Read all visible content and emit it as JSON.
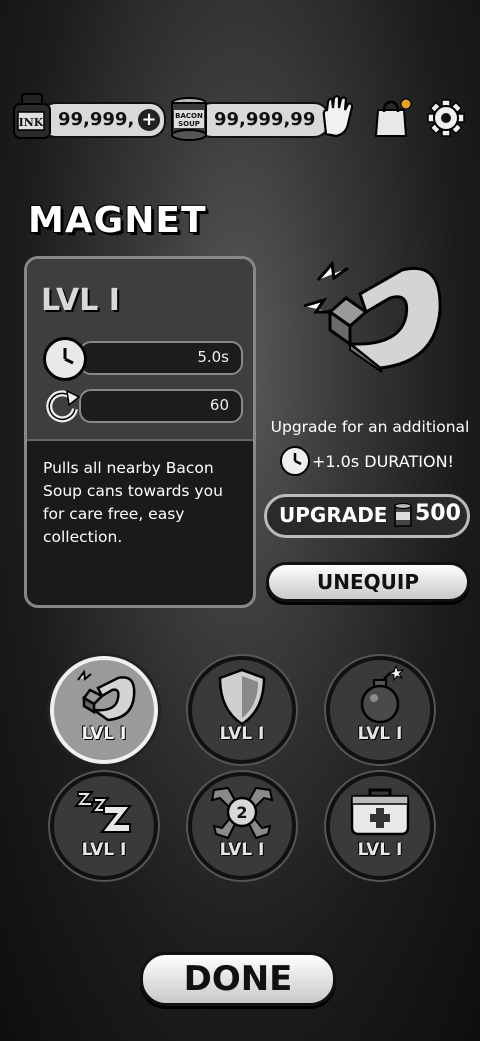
{
  "currency": {
    "ink_amount": "99,999,",
    "ink_label": "INK",
    "plus_label": "+",
    "soup_amount": "99,999,99",
    "soup_label_1": "BACON",
    "soup_label_2": "SOUP"
  },
  "header": {
    "title": "MAGNET"
  },
  "info": {
    "level": "LVL I",
    "duration_value": "5.0s",
    "cooldown_value": "60",
    "description": "Pulls all nearby Bacon Soup cans towards you for care free, easy collection."
  },
  "upgrade": {
    "text": "Upgrade for an additional",
    "bonus": "+1.0s DURATION!",
    "button_label": "UPGRADE",
    "cost": "500"
  },
  "unequip_label": "UNEQUIP",
  "powerups": [
    {
      "name": "magnet",
      "level": "LVL I",
      "selected": true
    },
    {
      "name": "shield",
      "level": "LVL I",
      "selected": false
    },
    {
      "name": "bomb",
      "level": "LVL I",
      "selected": false
    },
    {
      "name": "sleep",
      "level": "LVL I",
      "selected": false
    },
    {
      "name": "double",
      "level": "LVL I",
      "selected": false,
      "badge": "2"
    },
    {
      "name": "first-aid",
      "level": "LVL I",
      "selected": false
    }
  ],
  "done_label": "DONE",
  "colors": {
    "accent": "#e8a020",
    "panel": "#3e3e3e"
  }
}
